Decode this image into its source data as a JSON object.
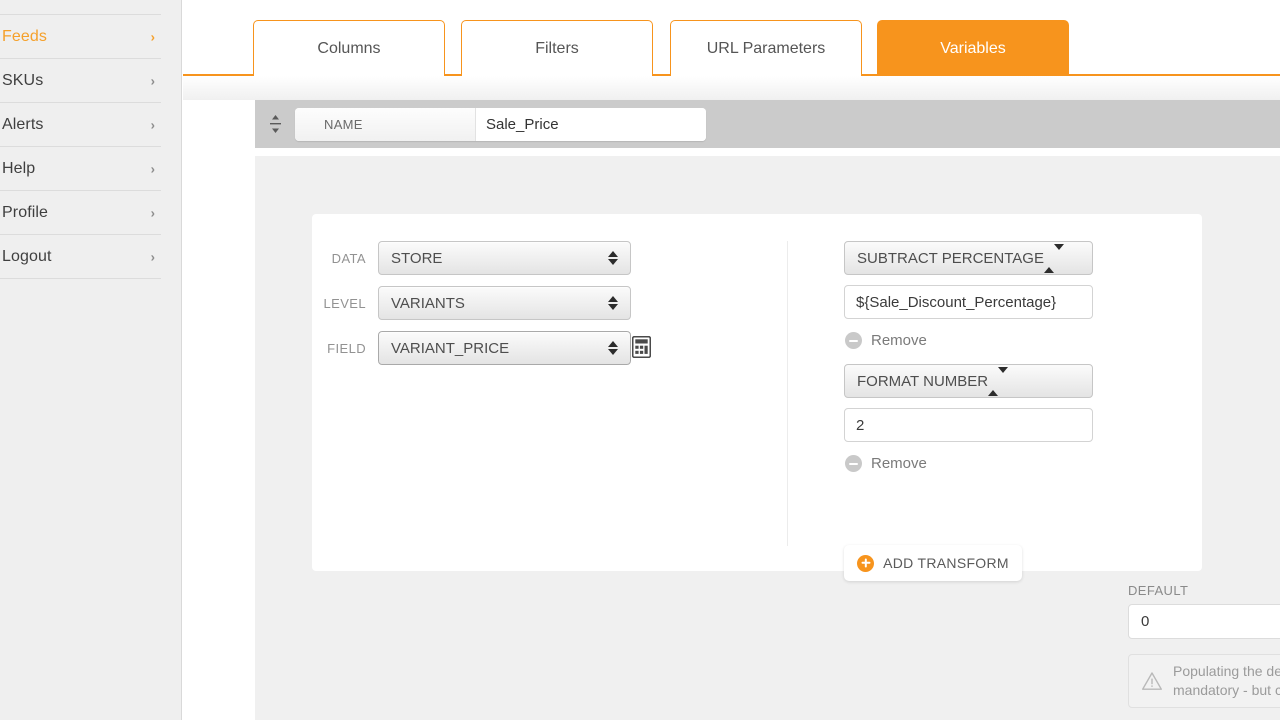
{
  "sidebar": {
    "items": [
      {
        "label": "Feeds",
        "icon": "chevron-right-icon",
        "active": true
      },
      {
        "label": "SKUs",
        "icon": "chevron-right-icon",
        "active": false
      },
      {
        "label": "Alerts",
        "icon": "chevron-right-icon",
        "active": false
      },
      {
        "label": "Help",
        "icon": "chevron-right-icon",
        "active": false
      },
      {
        "label": "Profile",
        "icon": "chevron-right-icon",
        "active": false
      },
      {
        "label": "Logout",
        "icon": "chevron-right-icon",
        "active": false
      }
    ]
  },
  "tabs": [
    {
      "label": "Columns",
      "active": false
    },
    {
      "label": "Filters",
      "active": false
    },
    {
      "label": "URL Parameters",
      "active": false
    },
    {
      "label": "Variables",
      "active": true
    }
  ],
  "name_row": {
    "drag_icon": "drag-vertical-icon",
    "legend": "NAME",
    "value": "Sale_Price",
    "placeholder": ""
  },
  "source": {
    "rows": [
      {
        "label": "DATA",
        "value": "STORE",
        "focused": false
      },
      {
        "label": "LEVEL",
        "value": "VARIANTS",
        "focused": false
      },
      {
        "label": "FIELD",
        "value": "VARIANT_PRICE",
        "focused": true
      }
    ],
    "calculator_icon": "calculator-icon"
  },
  "transforms": [
    {
      "type": "SUBTRACT PERCENTAGE",
      "value": "${Sale_Discount_Percentage}",
      "remove_label": "Remove",
      "remove_icon": "minus-circle-icon"
    },
    {
      "type": "FORMAT NUMBER",
      "value": "2",
      "remove_label": "Remove",
      "remove_icon": "minus-circle-icon"
    }
  ],
  "add_transform": {
    "label": "ADD TRANSFORM",
    "icon": "plus-circle-icon"
  },
  "default_section": {
    "label": "DEFAULT",
    "value": "0",
    "placeholder": "",
    "note_icon": "warning-triangle-icon",
    "note_text": "Populating the default value is not mandatory - but can prevent errors"
  },
  "colors": {
    "accent": "#f7941d",
    "accent_light": "#f5a02a",
    "sidebar_bg": "#efefef",
    "header_bar": "#cbcbcb",
    "body_bg": "#f0f0f0"
  }
}
